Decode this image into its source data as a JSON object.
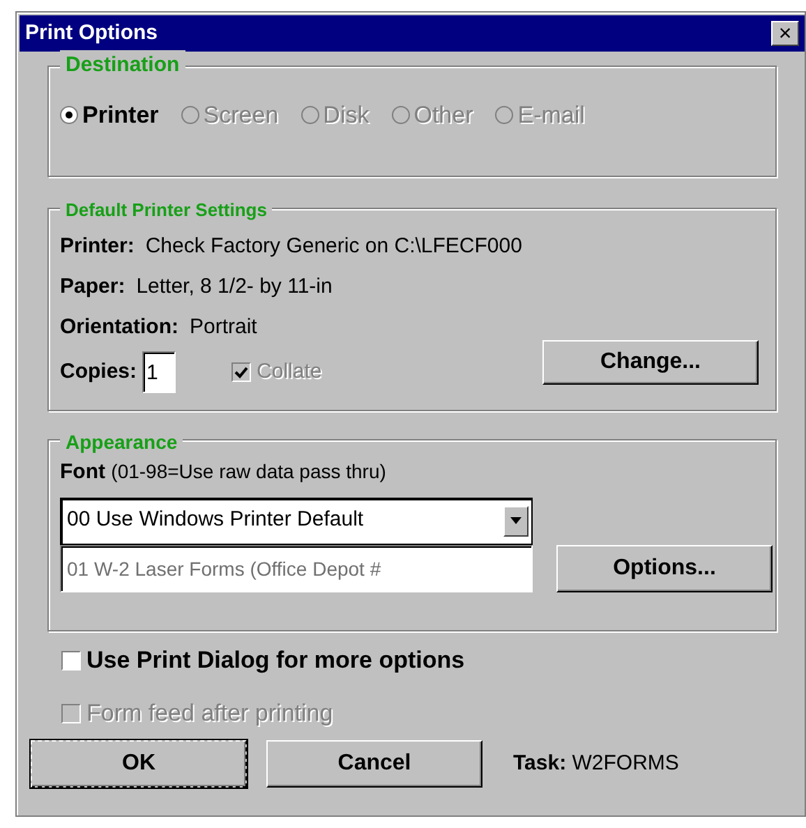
{
  "window": {
    "title": "Print Options",
    "close": "×"
  },
  "destination": {
    "title": "Destination",
    "options": [
      {
        "label": "Printer",
        "selected": true,
        "disabled": false
      },
      {
        "label": "Screen",
        "selected": false,
        "disabled": true
      },
      {
        "label": "Disk",
        "selected": false,
        "disabled": true
      },
      {
        "label": "Other",
        "selected": false,
        "disabled": true
      },
      {
        "label": "E-mail",
        "selected": false,
        "disabled": true
      }
    ]
  },
  "printer_settings": {
    "title": "Default Printer Settings",
    "rows": [
      {
        "label": "Printer:",
        "value": "Check Factory Generic on C:\\LFECF000"
      },
      {
        "label": "Paper:",
        "value": "Letter, 8 1/2- by 11-in"
      },
      {
        "label": "Orientation:",
        "value": "Portrait"
      }
    ],
    "copies_label": "Copies:",
    "copies": "1",
    "collate": {
      "label": "Collate",
      "checked": true,
      "disabled": true
    },
    "change_button": "Change..."
  },
  "appearance": {
    "title": "Appearance",
    "font_label": "Font",
    "font_hint": "(01-98=Use raw data pass thru)",
    "font_select": "00 Use Windows Printer Default",
    "font_field": {
      "value": "01 W-2 Laser Forms (Office Depot #",
      "disabled": true
    },
    "options_button": "Options..."
  },
  "checkboxes": [
    {
      "label": "Use Print Dialog for more options",
      "checked": false,
      "disabled": false
    },
    {
      "label": "Form feed after printing",
      "checked": false,
      "disabled": true
    }
  ],
  "buttons": [
    {
      "label": "OK",
      "default": true
    },
    {
      "label": "Cancel",
      "default": false
    }
  ],
  "task": {
    "label": "Task:",
    "value": "W2FORMS"
  }
}
